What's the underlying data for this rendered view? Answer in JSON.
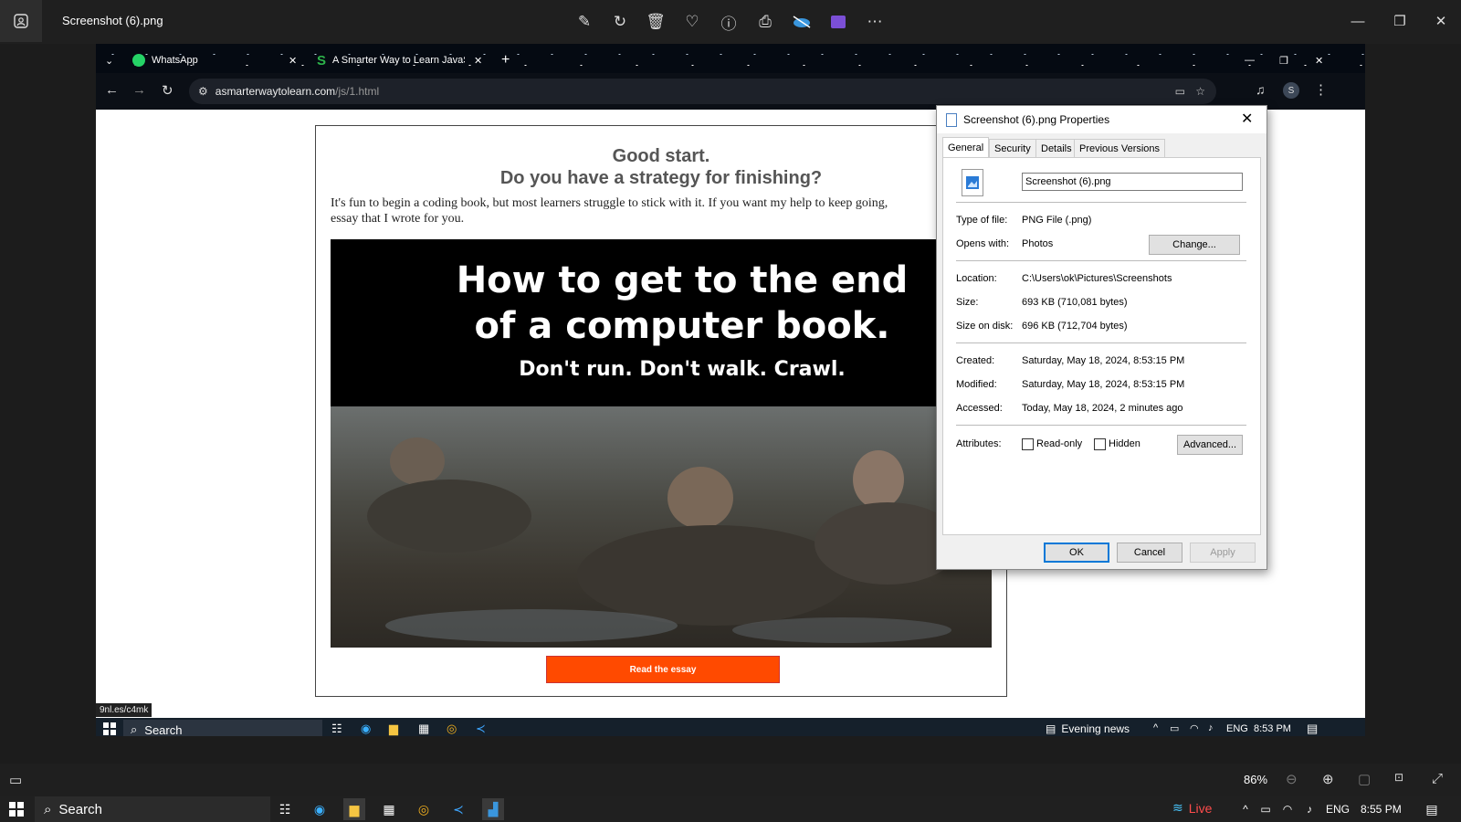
{
  "photos": {
    "title": "Screenshot (6).png",
    "zoom": "86%"
  },
  "browser": {
    "tabs": [
      {
        "label": "WhatsApp"
      },
      {
        "label": "A Smarter Way to Learn JavaScr"
      }
    ],
    "url_domain": "asmarterwaytolearn.com",
    "url_path": "/js/1.html",
    "profile_letter": "S",
    "status_link": "9nl.es/c4mk"
  },
  "page": {
    "headline1": "Good start.",
    "headline2": "Do you have a strategy for finishing?",
    "intro_line1": "It's fun to begin a coding book, but most learners struggle to stick with it. If you want my help to keep going,",
    "intro_line2": "essay that I wrote for you.",
    "image_head1": "How to get to the end",
    "image_head2": "of a computer book.",
    "image_sub": "Don't run. Don't walk. Crawl.",
    "button": "Read the essay"
  },
  "inner_taskbar": {
    "search": "Search",
    "news": "Evening news",
    "lang": "ENG",
    "time": "8:53 PM"
  },
  "properties": {
    "title": "Screenshot (6).png Properties",
    "tabs": [
      "General",
      "Security",
      "Details",
      "Previous Versions"
    ],
    "filename": "Screenshot (6).png",
    "rows1": [
      {
        "label": "Type of file:",
        "value": "PNG File (.png)"
      },
      {
        "label": "Opens with:",
        "value": "Photos"
      }
    ],
    "change_button": "Change...",
    "rows2": [
      {
        "label": "Location:",
        "value": "C:\\Users\\ok\\Pictures\\Screenshots"
      },
      {
        "label": "Size:",
        "value": "693 KB (710,081 bytes)"
      },
      {
        "label": "Size on disk:",
        "value": "696 KB (712,704 bytes)"
      }
    ],
    "rows3": [
      {
        "label": "Created:",
        "value": "Saturday, May 18, 2024, 8:53:15 PM"
      },
      {
        "label": "Modified:",
        "value": "Saturday, May 18, 2024, 8:53:15 PM"
      },
      {
        "label": "Accessed:",
        "value": "Today, May 18, 2024, 2 minutes ago"
      }
    ],
    "attributes_label": "Attributes:",
    "readonly": "Read-only",
    "hidden": "Hidden",
    "advanced": "Advanced...",
    "ok": "OK",
    "cancel": "Cancel",
    "apply": "Apply"
  },
  "taskbar": {
    "search": "Search",
    "live": "Live",
    "lang": "ENG",
    "time": "8:55 PM"
  },
  "colors": {
    "button_orange": "#ff4a00",
    "dialog_bg": "#f0f0f0",
    "ok_border": "#0078d7"
  }
}
